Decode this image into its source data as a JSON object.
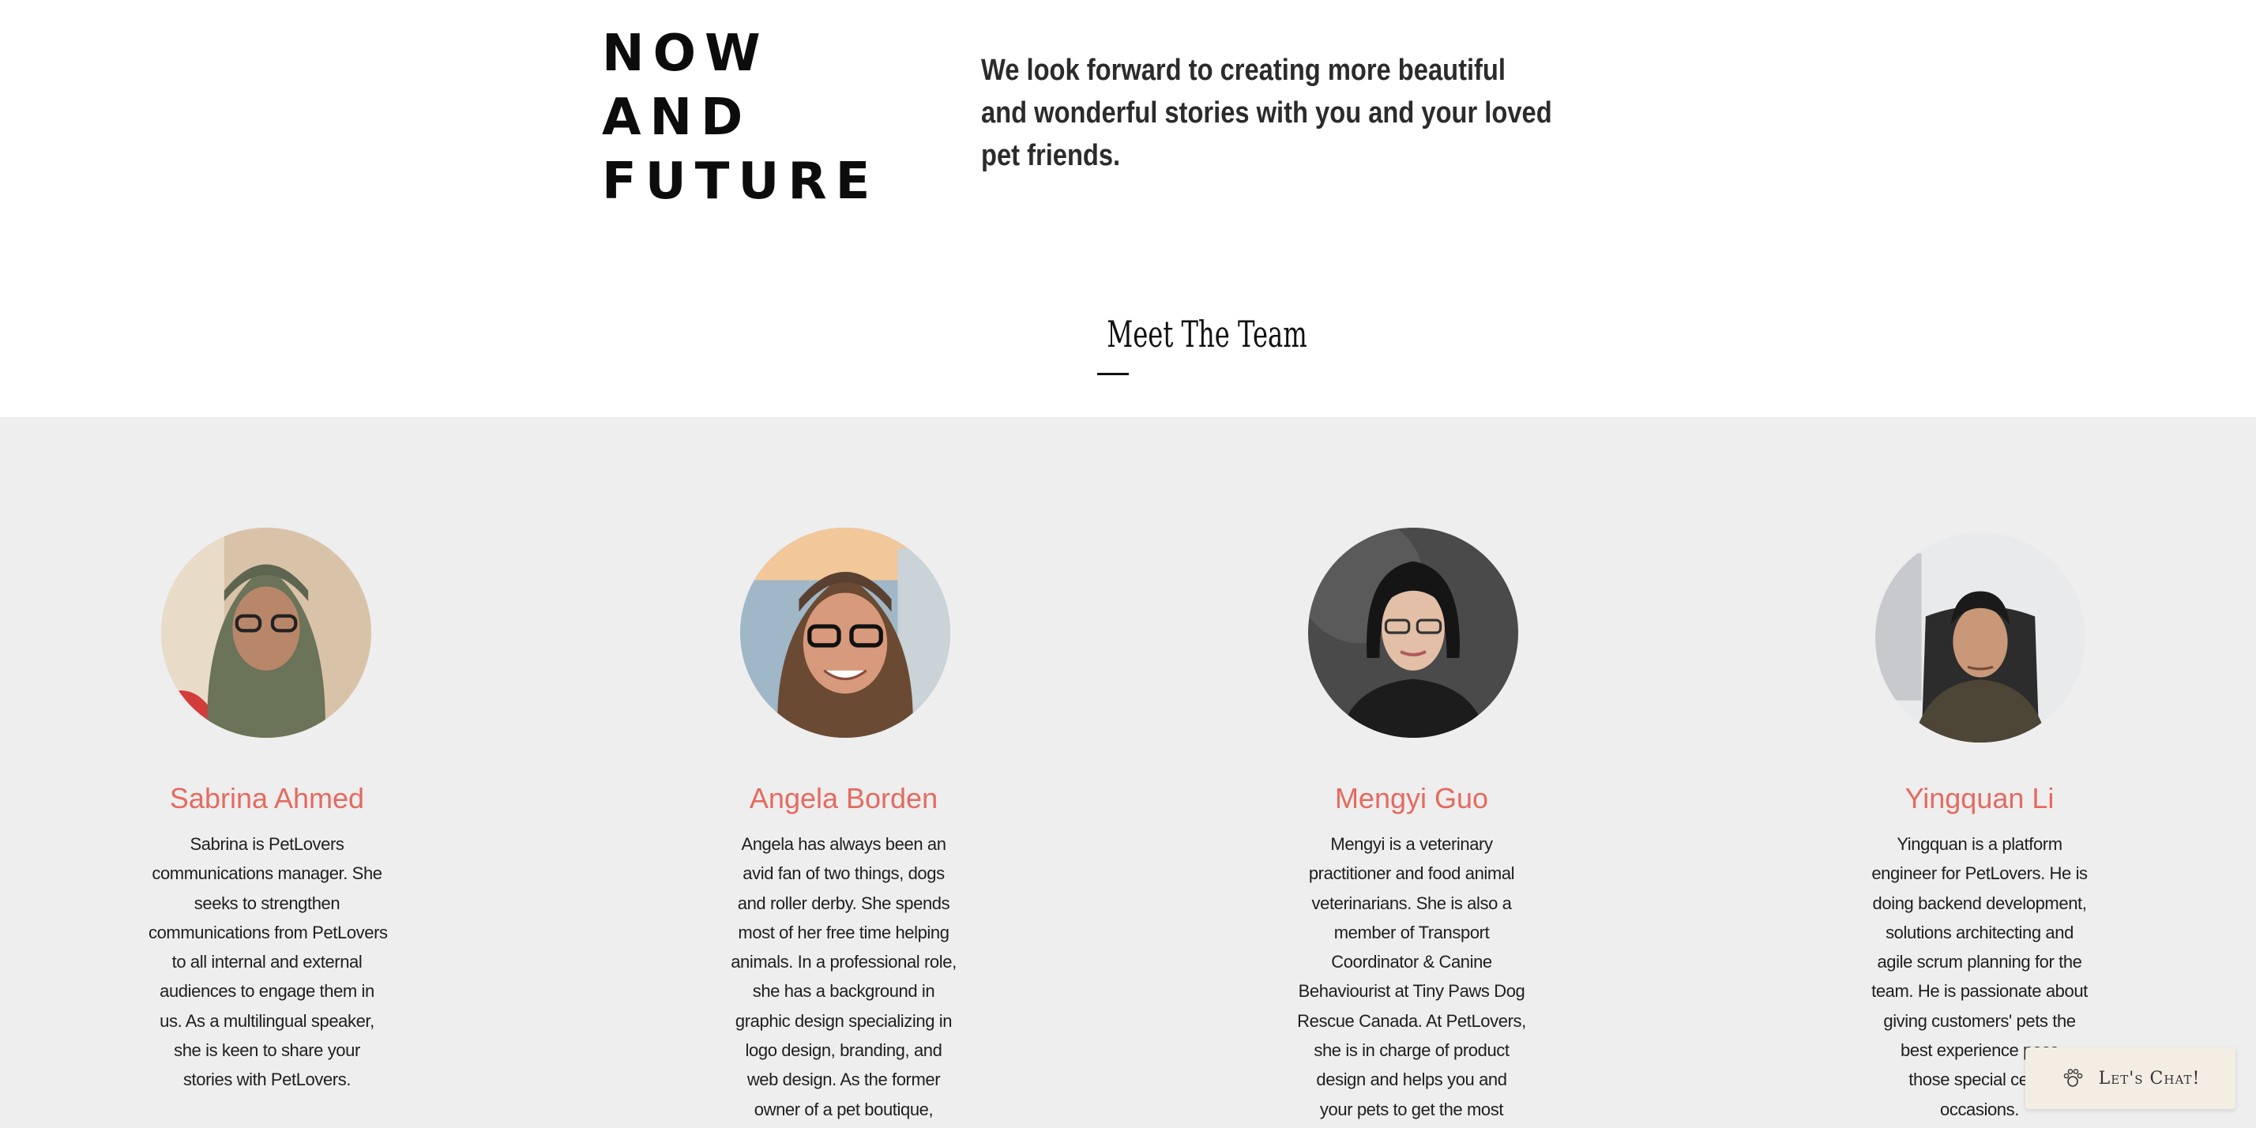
{
  "hero": {
    "heading_lines": [
      "NOW",
      "AND",
      "FUTURE"
    ],
    "intro_lines": [
      "We look forward to creating more beautiful",
      "and wonderful stories with you and your loved",
      "pet friends."
    ]
  },
  "team": {
    "title": "Meet The Team",
    "members": [
      {
        "name": "Sabrina Ahmed",
        "bio_lines": [
          "Sabrina is PetLovers",
          "communications manager. She",
          "seeks to strengthen",
          "communications from PetLovers",
          "to all internal and external",
          "audiences to engage them in",
          "us. As a multilingual speaker,",
          "she is keen to share your",
          "stories with PetLovers."
        ]
      },
      {
        "name": "Angela Borden",
        "bio_lines": [
          "Angela has always been an",
          "avid fan of two things, dogs",
          "and roller derby. She spends",
          "most of her free time helping",
          "animals. In a professional role,",
          "she has a background in",
          "graphic design specializing in",
          "logo design, branding, and",
          "web design. As the former",
          "owner of a pet boutique,"
        ]
      },
      {
        "name": "Mengyi Guo",
        "bio_lines": [
          "Mengyi is a veterinary",
          "practitioner and food animal",
          "veterinarians. She is also a",
          "member of Transport",
          "Coordinator & Canine",
          "Behaviourist at Tiny Paws Dog",
          "Rescue Canada. At PetLovers,",
          "she is in charge of product",
          "design and helps you and",
          "your pets to get the most"
        ]
      },
      {
        "name": "Yingquan Li",
        "bio_lines": [
          "Yingquan is a platform",
          "engineer for PetLovers. He is",
          "doing backend development,",
          "solutions architecting and",
          "agile scrum planning for the",
          "team. He is passionate about",
          "giving customers' pets the",
          "best experience poss",
          "those special celeb",
          "occasions."
        ]
      }
    ]
  },
  "chat": {
    "label": "Let's Chat!",
    "icon": "paw-chat-icon"
  },
  "colors": {
    "name_accent": "#e56a5f",
    "team_band_bg": "#eeeeee",
    "chat_bg": "#f3ede3"
  }
}
